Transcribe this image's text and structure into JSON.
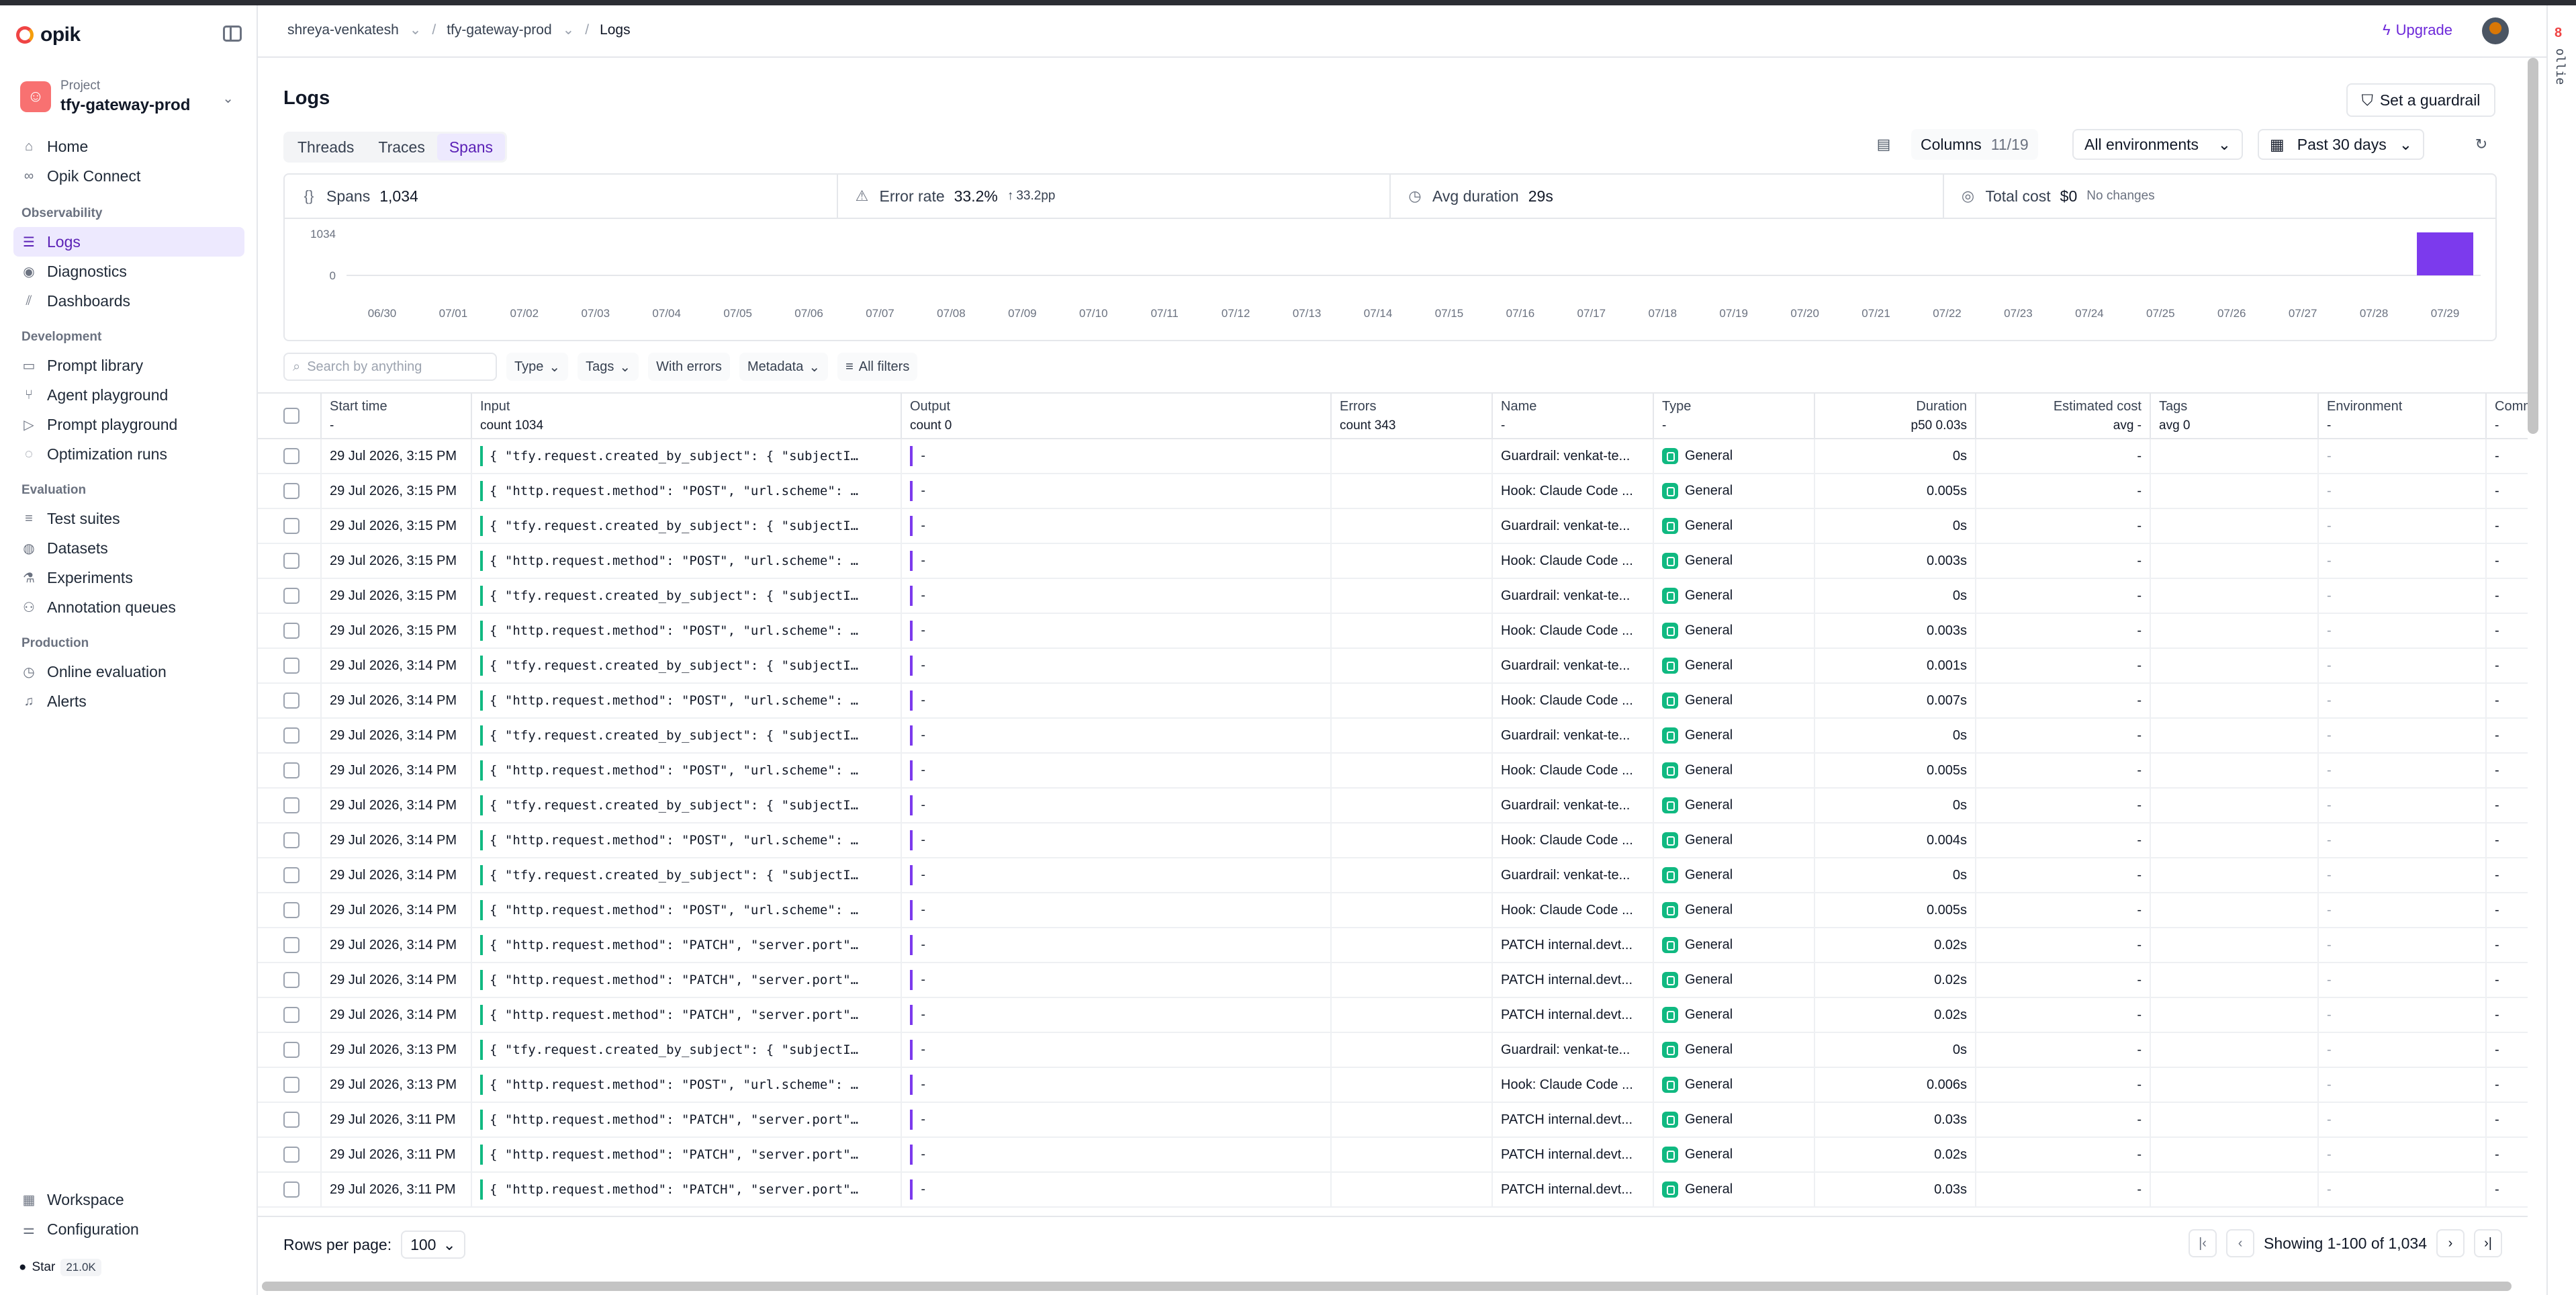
{
  "app": {
    "name": "opik"
  },
  "project": {
    "label": "Project",
    "name": "tfy-gateway-prod"
  },
  "nav": {
    "main": [
      {
        "label": "Home",
        "icon": "home-icon"
      },
      {
        "label": "Opik Connect",
        "icon": "link-icon"
      }
    ],
    "sections": [
      {
        "title": "Observability",
        "items": [
          {
            "label": "Logs",
            "icon": "list-icon",
            "active": true
          },
          {
            "label": "Diagnostics",
            "icon": "diagnostics-icon"
          },
          {
            "label": "Dashboards",
            "icon": "chart-icon"
          }
        ]
      },
      {
        "title": "Development",
        "items": [
          {
            "label": "Prompt library",
            "icon": "book-icon"
          },
          {
            "label": "Agent playground",
            "icon": "agent-icon"
          },
          {
            "label": "Prompt playground",
            "icon": "play-icon"
          },
          {
            "label": "Optimization runs",
            "icon": "sparkle-icon"
          }
        ]
      },
      {
        "title": "Evaluation",
        "items": [
          {
            "label": "Test suites",
            "icon": "test-icon"
          },
          {
            "label": "Datasets",
            "icon": "database-icon"
          },
          {
            "label": "Experiments",
            "icon": "flask-icon"
          },
          {
            "label": "Annotation queues",
            "icon": "users-icon"
          }
        ]
      },
      {
        "title": "Production",
        "items": [
          {
            "label": "Online evaluation",
            "icon": "gauge-icon"
          },
          {
            "label": "Alerts",
            "icon": "bell-icon"
          }
        ]
      }
    ],
    "bottom": [
      {
        "label": "Workspace",
        "icon": "grid-icon"
      },
      {
        "label": "Configuration",
        "icon": "sliders-icon"
      }
    ],
    "github": {
      "label": "Star",
      "count": "21.0K"
    }
  },
  "breadcrumbs": [
    {
      "label": "shreya-venkatesh"
    },
    {
      "label": "tfy-gateway-prod"
    },
    {
      "label": "Logs"
    }
  ],
  "header": {
    "upgrade": "Upgrade",
    "side_label": "ollie"
  },
  "page": {
    "title": "Logs",
    "guardrail_button": "Set a guardrail",
    "tabs": [
      {
        "label": "Threads",
        "active": false
      },
      {
        "label": "Traces",
        "active": false
      },
      {
        "label": "Spans",
        "active": true
      }
    ],
    "columns": {
      "label": "Columns",
      "count": "11/19"
    },
    "environment": "All environments",
    "date_range": "Past 30 days"
  },
  "stats": {
    "spans": {
      "label": "Spans",
      "value": "1,034"
    },
    "error_rate": {
      "label": "Error rate",
      "value": "33.2%",
      "delta": "33.2pp"
    },
    "avg_duration": {
      "label": "Avg duration",
      "value": "29s"
    },
    "total_cost": {
      "label": "Total cost",
      "value": "$0",
      "note": "No changes"
    }
  },
  "chart_data": {
    "type": "bar",
    "categories": [
      "06/30",
      "07/01",
      "07/02",
      "07/03",
      "07/04",
      "07/05",
      "07/06",
      "07/07",
      "07/08",
      "07/09",
      "07/10",
      "07/11",
      "07/12",
      "07/13",
      "07/14",
      "07/15",
      "07/16",
      "07/17",
      "07/18",
      "07/19",
      "07/20",
      "07/21",
      "07/22",
      "07/23",
      "07/24",
      "07/25",
      "07/26",
      "07/27",
      "07/28",
      "07/29"
    ],
    "values": [
      0,
      0,
      0,
      0,
      0,
      0,
      0,
      0,
      0,
      0,
      0,
      0,
      0,
      0,
      0,
      0,
      0,
      0,
      0,
      0,
      0,
      0,
      0,
      0,
      0,
      0,
      0,
      0,
      0,
      1034
    ],
    "yticks": [
      "1034",
      "0"
    ],
    "ylim": [
      0,
      1034
    ],
    "color": "#7c3aed"
  },
  "filters": {
    "search_placeholder": "Search by anything",
    "buttons": [
      {
        "label": "Type",
        "chevron": true
      },
      {
        "label": "Tags",
        "chevron": true
      },
      {
        "label": "With errors",
        "chevron": false
      },
      {
        "label": "Metadata",
        "chevron": true
      }
    ],
    "all_filters": "All filters"
  },
  "table": {
    "columns": [
      {
        "title": "Start time",
        "sub": "-"
      },
      {
        "title": "Input",
        "sub": "count 1034"
      },
      {
        "title": "Output",
        "sub": "count 0"
      },
      {
        "title": "Errors",
        "sub": "count 343"
      },
      {
        "title": "Name",
        "sub": "-"
      },
      {
        "title": "Type",
        "sub": "-"
      },
      {
        "title": "Duration",
        "sub": "p50 0.03s"
      },
      {
        "title": "Estimated cost",
        "sub": "avg -"
      },
      {
        "title": "Tags",
        "sub": "avg 0"
      },
      {
        "title": "Environment",
        "sub": "-"
      },
      {
        "title": "Comm",
        "sub": "-"
      }
    ],
    "rows": [
      {
        "start": "29 Jul 2026, 3:15 PM",
        "input": "{ \"tfy.request.created_by_subject\": { \"subjectId\": \"...",
        "output": "-",
        "errors": "",
        "name": "Guardrail: venkat-te...",
        "type": "General",
        "duration": "0s",
        "cost": "-",
        "tags": "",
        "env": "-",
        "comm": "-"
      },
      {
        "start": "29 Jul 2026, 3:15 PM",
        "input": "{ \"http.request.method\": \"POST\", \"url.scheme\": \"htt...",
        "output": "-",
        "errors": "",
        "name": "Hook: Claude Code ...",
        "type": "General",
        "duration": "0.005s",
        "cost": "-",
        "tags": "",
        "env": "-",
        "comm": "-"
      },
      {
        "start": "29 Jul 2026, 3:15 PM",
        "input": "{ \"tfy.request.created_by_subject\": { \"subjectId\": \"...",
        "output": "-",
        "errors": "",
        "name": "Guardrail: venkat-te...",
        "type": "General",
        "duration": "0s",
        "cost": "-",
        "tags": "",
        "env": "-",
        "comm": "-"
      },
      {
        "start": "29 Jul 2026, 3:15 PM",
        "input": "{ \"http.request.method\": \"POST\", \"url.scheme\": \"htt...",
        "output": "-",
        "errors": "",
        "name": "Hook: Claude Code ...",
        "type": "General",
        "duration": "0.003s",
        "cost": "-",
        "tags": "",
        "env": "-",
        "comm": "-"
      },
      {
        "start": "29 Jul 2026, 3:15 PM",
        "input": "{ \"tfy.request.created_by_subject\": { \"subjectId\": \"...",
        "output": "-",
        "errors": "",
        "name": "Guardrail: venkat-te...",
        "type": "General",
        "duration": "0s",
        "cost": "-",
        "tags": "",
        "env": "-",
        "comm": "-"
      },
      {
        "start": "29 Jul 2026, 3:15 PM",
        "input": "{ \"http.request.method\": \"POST\", \"url.scheme\": \"htt...",
        "output": "-",
        "errors": "",
        "name": "Hook: Claude Code ...",
        "type": "General",
        "duration": "0.003s",
        "cost": "-",
        "tags": "",
        "env": "-",
        "comm": "-"
      },
      {
        "start": "29 Jul 2026, 3:14 PM",
        "input": "{ \"tfy.request.created_by_subject\": { \"subjectId\": \"...",
        "output": "-",
        "errors": "",
        "name": "Guardrail: venkat-te...",
        "type": "General",
        "duration": "0.001s",
        "cost": "-",
        "tags": "",
        "env": "-",
        "comm": "-"
      },
      {
        "start": "29 Jul 2026, 3:14 PM",
        "input": "{ \"http.request.method\": \"POST\", \"url.scheme\": \"htt...",
        "output": "-",
        "errors": "",
        "name": "Hook: Claude Code ...",
        "type": "General",
        "duration": "0.007s",
        "cost": "-",
        "tags": "",
        "env": "-",
        "comm": "-"
      },
      {
        "start": "29 Jul 2026, 3:14 PM",
        "input": "{ \"tfy.request.created_by_subject\": { \"subjectId\": \"...",
        "output": "-",
        "errors": "",
        "name": "Guardrail: venkat-te...",
        "type": "General",
        "duration": "0s",
        "cost": "-",
        "tags": "",
        "env": "-",
        "comm": "-"
      },
      {
        "start": "29 Jul 2026, 3:14 PM",
        "input": "{ \"http.request.method\": \"POST\", \"url.scheme\": \"htt...",
        "output": "-",
        "errors": "",
        "name": "Hook: Claude Code ...",
        "type": "General",
        "duration": "0.005s",
        "cost": "-",
        "tags": "",
        "env": "-",
        "comm": "-"
      },
      {
        "start": "29 Jul 2026, 3:14 PM",
        "input": "{ \"tfy.request.created_by_subject\": { \"subjectId\": \"...",
        "output": "-",
        "errors": "",
        "name": "Guardrail: venkat-te...",
        "type": "General",
        "duration": "0s",
        "cost": "-",
        "tags": "",
        "env": "-",
        "comm": "-"
      },
      {
        "start": "29 Jul 2026, 3:14 PM",
        "input": "{ \"http.request.method\": \"POST\", \"url.scheme\": \"htt...",
        "output": "-",
        "errors": "",
        "name": "Hook: Claude Code ...",
        "type": "General",
        "duration": "0.004s",
        "cost": "-",
        "tags": "",
        "env": "-",
        "comm": "-"
      },
      {
        "start": "29 Jul 2026, 3:14 PM",
        "input": "{ \"tfy.request.created_by_subject\": { \"subjectId\": \"...",
        "output": "-",
        "errors": "",
        "name": "Guardrail: venkat-te...",
        "type": "General",
        "duration": "0s",
        "cost": "-",
        "tags": "",
        "env": "-",
        "comm": "-"
      },
      {
        "start": "29 Jul 2026, 3:14 PM",
        "input": "{ \"http.request.method\": \"POST\", \"url.scheme\": \"htt...",
        "output": "-",
        "errors": "",
        "name": "Hook: Claude Code ...",
        "type": "General",
        "duration": "0.005s",
        "cost": "-",
        "tags": "",
        "env": "-",
        "comm": "-"
      },
      {
        "start": "29 Jul 2026, 3:14 PM",
        "input": "{ \"http.request.method\": \"PATCH\", \"server.port\": 44...",
        "output": "-",
        "errors": "",
        "name": "PATCH internal.devt...",
        "type": "General",
        "duration": "0.02s",
        "cost": "-",
        "tags": "",
        "env": "-",
        "comm": "-"
      },
      {
        "start": "29 Jul 2026, 3:14 PM",
        "input": "{ \"http.request.method\": \"PATCH\", \"server.port\": 44...",
        "output": "-",
        "errors": "",
        "name": "PATCH internal.devt...",
        "type": "General",
        "duration": "0.02s",
        "cost": "-",
        "tags": "",
        "env": "-",
        "comm": "-"
      },
      {
        "start": "29 Jul 2026, 3:14 PM",
        "input": "{ \"http.request.method\": \"PATCH\", \"server.port\": 44...",
        "output": "-",
        "errors": "",
        "name": "PATCH internal.devt...",
        "type": "General",
        "duration": "0.02s",
        "cost": "-",
        "tags": "",
        "env": "-",
        "comm": "-"
      },
      {
        "start": "29 Jul 2026, 3:13 PM",
        "input": "{ \"tfy.request.created_by_subject\": { \"subjectId\": \"...",
        "output": "-",
        "errors": "",
        "name": "Guardrail: venkat-te...",
        "type": "General",
        "duration": "0s",
        "cost": "-",
        "tags": "",
        "env": "-",
        "comm": "-"
      },
      {
        "start": "29 Jul 2026, 3:13 PM",
        "input": "{ \"http.request.method\": \"POST\", \"url.scheme\": \"htt...",
        "output": "-",
        "errors": "",
        "name": "Hook: Claude Code ...",
        "type": "General",
        "duration": "0.006s",
        "cost": "-",
        "tags": "",
        "env": "-",
        "comm": "-"
      },
      {
        "start": "29 Jul 2026, 3:11 PM",
        "input": "{ \"http.request.method\": \"PATCH\", \"server.port\": 44...",
        "output": "-",
        "errors": "",
        "name": "PATCH internal.devt...",
        "type": "General",
        "duration": "0.03s",
        "cost": "-",
        "tags": "",
        "env": "-",
        "comm": "-"
      },
      {
        "start": "29 Jul 2026, 3:11 PM",
        "input": "{ \"http.request.method\": \"PATCH\", \"server.port\": 44...",
        "output": "-",
        "errors": "",
        "name": "PATCH internal.devt...",
        "type": "General",
        "duration": "0.02s",
        "cost": "-",
        "tags": "",
        "env": "-",
        "comm": "-"
      },
      {
        "start": "29 Jul 2026, 3:11 PM",
        "input": "{ \"http.request.method\": \"PATCH\", \"server.port\": 44...",
        "output": "-",
        "errors": "",
        "name": "PATCH internal.devt...",
        "type": "General",
        "duration": "0.03s",
        "cost": "-",
        "tags": "",
        "env": "-",
        "comm": "-"
      }
    ]
  },
  "pagination": {
    "rows_per_page_label": "Rows per page:",
    "rows_per_page": "100",
    "showing": "Showing 1-100 of 1,034"
  },
  "colors": {
    "accent": "#7c3aed",
    "active_bg": "#ede9fe",
    "type_badge": "#10b981"
  }
}
